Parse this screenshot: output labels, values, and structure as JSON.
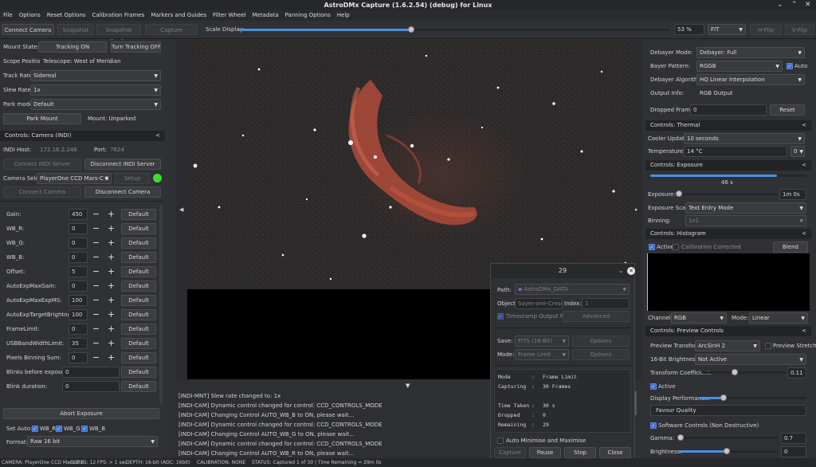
{
  "window": {
    "title": "AstroDMx Capture (1.6.2.54) (debug) for Linux"
  },
  "menu": [
    "File",
    "Options",
    "Reset Options",
    "Calibration Frames",
    "Markers and Guides",
    "Filter Wheel",
    "Metadata",
    "Panning Options",
    "Help"
  ],
  "toolbar": {
    "connect": "Connect Camera",
    "snapshot": "Snapshot",
    "snapshot_config": "Snapshot Config",
    "capture": "Capture",
    "scale_label": "Scale Display:",
    "scale_value": "53 %",
    "fit": "FIT",
    "hflip": "H-Flip",
    "vflip": "V-Flip",
    "scale_fraction": 0.4
  },
  "mount": {
    "state_label": "Mount State:",
    "state_btn": "Tracking ON",
    "turn_off": "Turn Tracking OFF",
    "scope_label": "Scope Position:",
    "scope_value": "Telescope: West of Meridian",
    "track_label": "Track Rate:",
    "track_value": "Sidereal",
    "slew_label": "Slew Rate:",
    "slew_value": "1x",
    "park_label": "Park mode:",
    "park_value": "Default",
    "park_btn": "Park Mount",
    "park_status": "Mount: Unparked"
  },
  "indi": {
    "section": "Controls: Camera (INDI)",
    "host_label": "INDI Host:",
    "host_value": "172.16.2.248",
    "port_label": "Port:",
    "port_value": "7624",
    "connect_server": "Connect INDI Server",
    "disconnect_server": "Disconnect INDI Server",
    "camsel_label": "Camera Select:",
    "camsel_value": "PlayerOne CCD Mars-C II",
    "setup": "Setup",
    "connect_cam": "Connect Camera",
    "disconnect_cam": "Disconnect Camera"
  },
  "controls": [
    {
      "label": "Gain:",
      "value": "450",
      "default": "Default",
      "stepper": true
    },
    {
      "label": "WB_R:",
      "value": "0",
      "default": "Default",
      "stepper": true
    },
    {
      "label": "WB_G:",
      "value": "0",
      "default": "Default",
      "stepper": true
    },
    {
      "label": "WB_B:",
      "value": "0",
      "default": "Default",
      "stepper": true
    },
    {
      "label": "Offset:",
      "value": "5",
      "default": "Default",
      "stepper": true
    },
    {
      "label": "AutoExpMaxGain:",
      "value": "0",
      "default": "Default",
      "stepper": true
    },
    {
      "label": "AutoExpMaxExpMS:",
      "value": "100",
      "default": "Default",
      "stepper": true
    },
    {
      "label": "AutoExpTargetBrightness:",
      "value": "100",
      "default": "Default",
      "stepper": true
    },
    {
      "label": "FrameLimit:",
      "value": "0",
      "default": "Default",
      "stepper": true
    },
    {
      "label": "USBBandWidthLimit:",
      "value": "35",
      "default": "Default",
      "stepper": true
    },
    {
      "label": "Pixels Binning Sum:",
      "value": "0",
      "default": "Default",
      "stepper": true
    },
    {
      "label": "Blinks before exposure:",
      "value": "0",
      "default": "Default",
      "stepper": false
    },
    {
      "label": "Blink duration:",
      "value": "0",
      "default": "Default",
      "stepper": false
    }
  ],
  "abort": "Abort Exposure",
  "setauto": {
    "label": "Set Auto:",
    "r": "WB_R",
    "g": "WB_G",
    "b": "WB_B"
  },
  "format": {
    "label": "Format:",
    "value": "Raw 16 bit"
  },
  "log": [
    "[INDI-MNT] Slew rate changed to: 1x",
    "[INDI-CAM] Dynamic control changed for control: CCD_CONTROLS_MODE",
    "[INDI-CAM] Changing Control AUTO_WB_B to ON, please wait...",
    "[INDI-CAM] Dynamic control changed for control: CCD_CONTROLS_MODE",
    "[INDI-CAM] Changing Control AUTO_WB_G to ON, please wait...",
    "[INDI-CAM] Dynamic control changed for control: CCD_CONTROLS_MODE",
    "[INDI-CAM] Changing Control AUTO_WB_R to ON, please wait..."
  ],
  "capture_dialog": {
    "title": "29",
    "path_label": "Path:",
    "path_value": "AstroDMx_DATA",
    "object_label": "Object:",
    "object_value": "Sayer-one-Crescent",
    "index_label": "Index:",
    "index_value": "1",
    "timestamp": "Timestamp Output Files",
    "advanced": "Advanced",
    "save_label": "Save:",
    "save_value": "FITS (16-Bit)",
    "options": "Options",
    "mode_label": "Mode:",
    "mode_value": "Frame Limit",
    "options2": "Options",
    "info": [
      [
        "Mode",
        ":",
        "Frame Limit"
      ],
      [
        "Capturing",
        ":",
        "30 Frames"
      ],
      [
        "",
        "",
        " "
      ],
      [
        "Time Taken",
        ":",
        "30 s"
      ],
      [
        "Dropped",
        ":",
        "0"
      ],
      [
        "Remaining",
        ":",
        "29"
      ]
    ],
    "auto_min": "Auto Minimise and Maximise",
    "capture": "Capture",
    "pause": "Pause",
    "stop": "Stop",
    "close": "Close"
  },
  "right": {
    "debayer_label": "Debayer Mode:",
    "debayer_value": "Debayer: Full",
    "bayer_label": "Bayer Pattern:",
    "bayer_value": "RGGB",
    "auto": "Auto",
    "algo_label": "Debayer Algorithm:",
    "algo_value": "HQ Linear Interpolation",
    "output_label": "Output Info:",
    "output_value": "RGB Output",
    "dropped_label": "Dropped Frames:",
    "dropped_value": "0",
    "reset": "Reset",
    "thermal": "Controls: Thermal",
    "cooler_label": "Cooler Update:",
    "cooler_value": "10 seconds",
    "temp_label": "Temperature:",
    "temp_value": "14 °C",
    "temp_sel": "0",
    "exposure_sec": "Controls: Exposure",
    "exp_progress": "46 s",
    "exp_fraction": 0.81,
    "exp_label": "Exposure:",
    "exp_value": "1m 0s",
    "expscale_label": "Exposure Scale:",
    "expscale_value": "Text Entry Mode",
    "binning_label": "Binning:",
    "binning_value": "1x1",
    "histogram": "Controls: Histogram",
    "active": "Active",
    "calcorr": "Calibration Corrected",
    "blend": "Blend",
    "channel_label": "Channel:",
    "channel_value": "RGB",
    "mode_label": "Mode:",
    "mode_value": "Linear",
    "preview": "Controls: Preview Controls",
    "ptrans_label": "Preview Transform:",
    "ptrans_value": "ArcSinH 2",
    "pstretch": "Preview Stretch",
    "bright16_label": "16-Bit Brightness:",
    "bright16_value": "Not Active",
    "tcoef_label": "Transform Coefficient:",
    "tcoef_value": "0.11",
    "active2": "Active",
    "dperf_label": "Display Performance:",
    "favour": "Favour Quality",
    "softctl": "Software Controls (Non Destructive)",
    "gamma_label": "Gamma:",
    "gamma_value": "0.7",
    "brightness_label": "Brightness:",
    "brightness_value": "0"
  },
  "statusbar": [
    "CAMERA: PlayerOne CCD Mars-C II",
    "CORES: 12",
    "FPS: > 1 sec",
    "DEPTH: 16-bit (ADC: 16bit)",
    "CALIBRATION: NONE",
    "STATUS: Captured 1 of 30 | Time Remaining = 29m 0s"
  ],
  "colors": {
    "accent": "#4a8fe0",
    "led": "#3cdc2e"
  }
}
